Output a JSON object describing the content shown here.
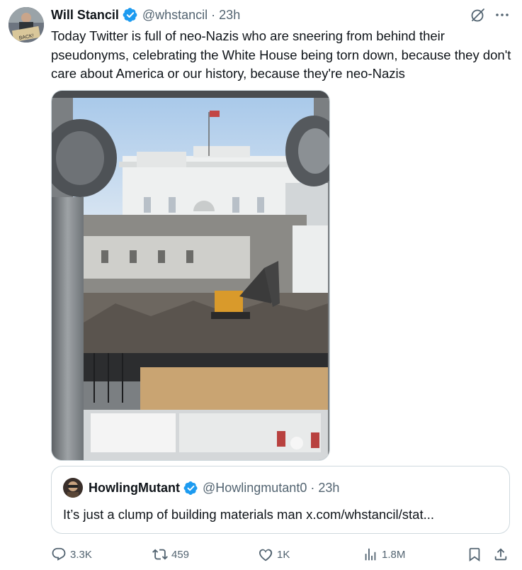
{
  "tweet": {
    "author_name": "Will Stancil",
    "handle": "@whstancil",
    "separator": "·",
    "time": "23h",
    "text": "Today Twitter is full of neo-Nazis who are sneering from behind their pseudonyms, celebrating the White House being torn down, because they don't care about America or our history, because they're neo-Nazis",
    "avatar_sign_text": "BACK!"
  },
  "quote": {
    "author_name": "HowlingMutant",
    "handle": "@Howlingmutant0",
    "separator": "·",
    "time": "23h",
    "text": "It’s just a clump of building materials man x.com/whstancil/stat..."
  },
  "actions": {
    "replies": "3.3K",
    "reposts": "459",
    "likes": "1K",
    "views": "1.8M"
  },
  "icons": {
    "verified": "verified-badge-icon",
    "grok": "grok-icon",
    "more": "more-icon",
    "reply": "reply-icon",
    "repost": "repost-icon",
    "like": "like-icon",
    "views": "views-icon",
    "bookmark": "bookmark-icon",
    "share": "share-icon"
  },
  "colors": {
    "text_primary": "#0f1419",
    "text_secondary": "#536471",
    "verified_blue": "#1d9bf0",
    "border": "#cfd9de"
  }
}
